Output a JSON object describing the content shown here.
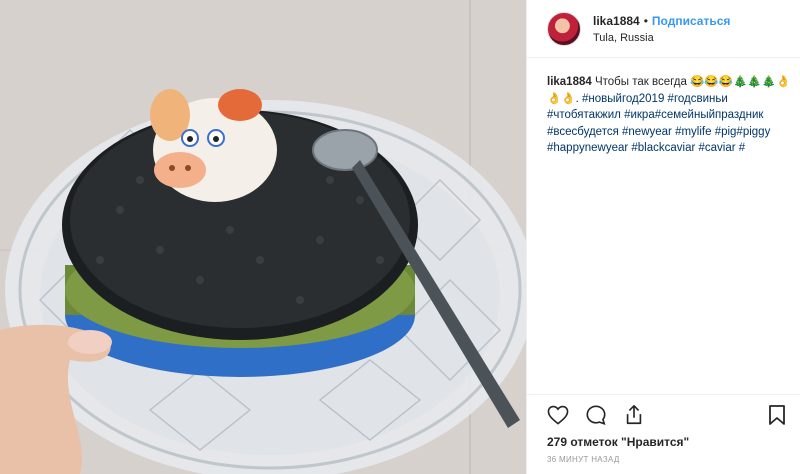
{
  "post": {
    "image_alt": "Black caviar in a crystal dish with a ceramic pig figurine"
  },
  "header": {
    "username": "lika1884",
    "separator": "•",
    "follow_label": "Подписаться",
    "location": "Tula, Russia"
  },
  "caption": {
    "username": "lika1884",
    "text": " Чтобы так всегда 😂😂😂🎄🎄🎄👌👌👌. ",
    "hashtags": "#новыйгод2019 #годсвиньи #чтобятакжил #икра#семейныйпраздник #всесбудется #newyear #mylife #pig#piggy #happynewyear #blackcaviar #caviar #"
  },
  "actions": {
    "like_icon": "heart-icon",
    "comment_icon": "comment-icon",
    "share_icon": "share-icon",
    "save_icon": "bookmark-icon",
    "likes_text": "279 отметок \"Нравится\"",
    "time_text": "36 минут назад"
  },
  "colors": {
    "link": "#3897f0",
    "hashtag": "#003569",
    "text": "#262626",
    "muted": "#999999",
    "border": "#efefef"
  }
}
